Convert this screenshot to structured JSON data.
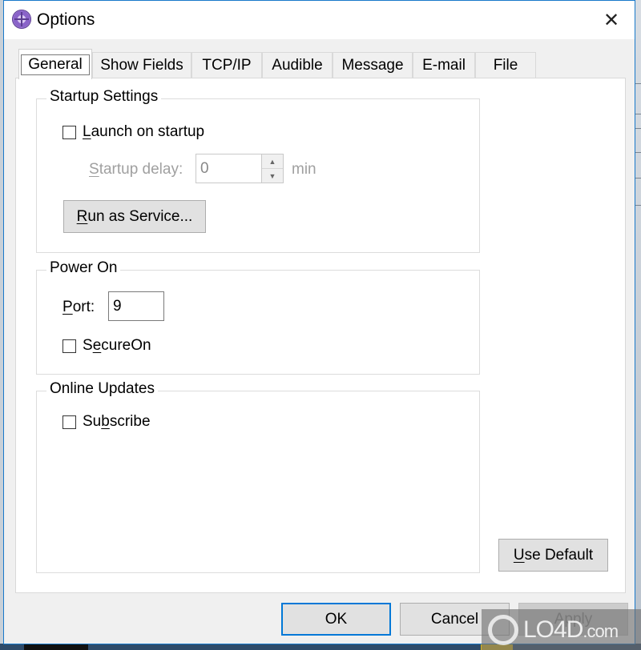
{
  "window": {
    "title": "Options",
    "app_icon": "app-crosshair-icon",
    "close_glyph": "✕"
  },
  "tabs": [
    {
      "label": "General",
      "active": true
    },
    {
      "label": "Show Fields",
      "active": false
    },
    {
      "label": "TCP/IP",
      "active": false
    },
    {
      "label": "Audible",
      "active": false
    },
    {
      "label": "Message",
      "active": false
    },
    {
      "label": "E-mail",
      "active": false
    },
    {
      "label": "File",
      "active": false
    }
  ],
  "startup_settings": {
    "title": "Startup Settings",
    "launch_on_startup": {
      "label_u": "L",
      "label_rest": "aunch on startup",
      "checked": false
    },
    "startup_delay": {
      "label_u": "S",
      "label_rest": "tartup delay:",
      "value": "0",
      "unit": "min",
      "enabled": false
    },
    "run_as_service": {
      "label_u": "R",
      "label_rest": "un as Service..."
    }
  },
  "power_on": {
    "title": "Power On",
    "port": {
      "label_u": "P",
      "label_rest": "ort:",
      "value": "9"
    },
    "secure_on": {
      "label_pre": "S",
      "label_u": "e",
      "label_rest": "cureOn",
      "checked": false
    }
  },
  "online_updates": {
    "title": "Online Updates",
    "subscribe": {
      "label_pre": "Su",
      "label_u": "b",
      "label_rest": "scribe",
      "checked": false
    }
  },
  "use_default": {
    "label_u": "U",
    "label_rest": "se Default"
  },
  "footer": {
    "ok": "OK",
    "cancel": "Cancel",
    "apply": "Apply"
  },
  "watermark": {
    "text": "LO4D",
    "suffix": ".com"
  },
  "colors": {
    "accent": "#0078d7",
    "window_border": "#1979ca",
    "disabled_text": "#a0a0a0"
  }
}
